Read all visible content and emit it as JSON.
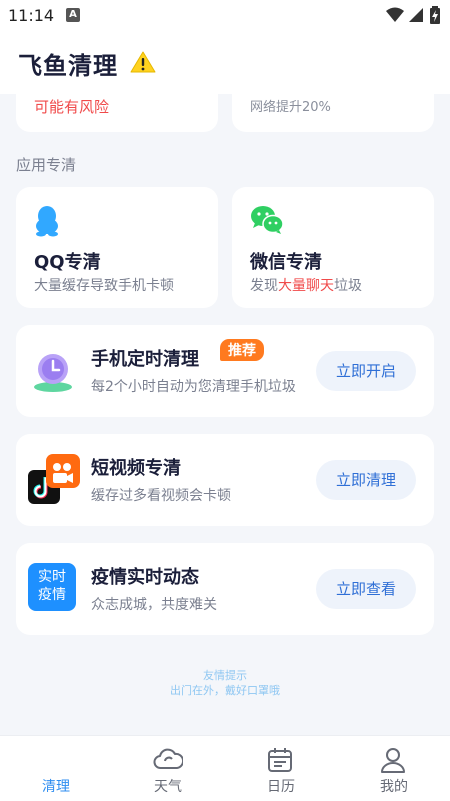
{
  "status_bar": {
    "time": "11:14",
    "notification_glyph": "A"
  },
  "header": {
    "title": "飞鱼清理"
  },
  "top_cards": [
    {
      "text": "可能有风险"
    },
    {
      "text": "网络提升20%"
    }
  ],
  "section": {
    "title": "应用专清"
  },
  "app_cards": [
    {
      "icon": "qq-penguin-icon",
      "name": "QQ专清",
      "desc": "大量缓存导致手机卡顿"
    },
    {
      "icon": "wechat-icon",
      "name": "微信专清",
      "desc_prefix": "发现",
      "desc_highlight": "大量聊天",
      "desc_suffix": "垃圾"
    }
  ],
  "feature_rows": [
    {
      "icon": "alarm-clock-icon",
      "title": "手机定时清理",
      "badge": "推荐",
      "desc": "每2个小时自动为您清理手机垃圾",
      "button": "立即开启"
    },
    {
      "icon": "short-video-icon",
      "title": "短视频专清",
      "desc": "缓存过多看视频会卡顿",
      "button": "立即清理"
    },
    {
      "icon": "epidemic-news-icon",
      "icon_text_line1": "实时",
      "icon_text_line2": "疫情",
      "title": "疫情实时动态",
      "desc": "众志成城，共度难关",
      "button": "立即查看"
    }
  ],
  "tip": {
    "line1": "友情提示",
    "line2": "出门在外，戴好口罩哦"
  },
  "tabbar": {
    "active": "清理",
    "tabs": [
      {
        "label": "清理",
        "icon": ""
      },
      {
        "label": "天气",
        "icon": "cloud-icon"
      },
      {
        "label": "日历",
        "icon": "calendar-icon"
      },
      {
        "label": "我的",
        "icon": "person-icon"
      }
    ]
  },
  "colors": {
    "accent": "#2f8ef0",
    "danger": "#f04a4a",
    "badge": "#ff7a1f",
    "button_text": "#2f6fd6"
  }
}
